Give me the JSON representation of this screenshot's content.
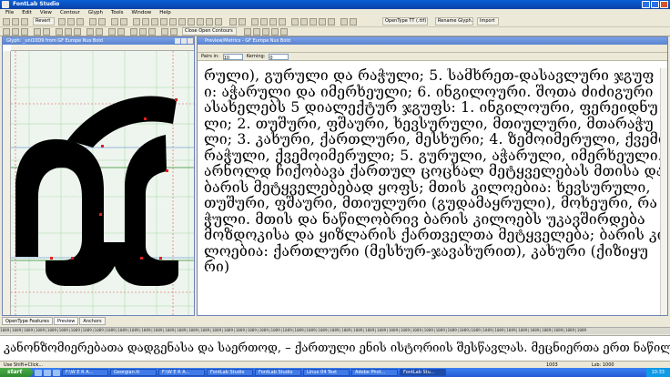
{
  "app": {
    "title": "FontLab Studio"
  },
  "menu": [
    "File",
    "Edit",
    "View",
    "Contour",
    "Glyph",
    "Tools",
    "Window",
    "Help"
  ],
  "toolbar": {
    "revert_label": "Revert",
    "layer_dropdown": "OpenType TT (.ttf)",
    "rename_glyph_label": "Rename Glyph...",
    "import_label": "Import",
    "close_contours_label": "Close Open Contours"
  },
  "glyph_window": {
    "title": "Glyph: _uni10D9 from GF Europe Nus Bold"
  },
  "preview_window": {
    "title": "Preview/Metrics - GF Europe Nus Bold",
    "pairs_label": "Pairs in:",
    "pairs_value": "10",
    "kerning_label": "Kerning:",
    "kerning_value": "0",
    "text_lines": [
      "რული), გურული და რაჭული; 5. სამხრეთ-დასავლური ჯგუფ",
      "ი: აჭარული და იმერხეული; 6. ინგილოური. შოთა ძიძიგური",
      "ასახელებს 5 დიალექტურ ჯგუფს: 1. ინგილოური, ფერეიდნუ",
      "ლი; 2. თუშური, ფშაური, ხევსურული, მთიულური, მთარაჭუ",
      "ლი; 3. კახური, ქართლური, მესხური; 4. ზემოიმერული, ქვემო",
      "რაჭული, ქვემოიმერული; 5. გურული, აჭარული, იმერხეული.",
      "არნოლდ ჩიქობავა ქართულ ცოცხალ მეტყველებას მთისა და",
      " ბარის მეტყველებებად ყოფს; მთის კილოებია: ხევსურული,",
      "თუშური, ფშაური, მთიულური (გუდამაყრული), მოხეური, რა",
      "ჭული. მთის და ნაწილობრივ ბარის კილოებს უკავშირდება",
      "მოზდოკისა და ყიზლარის ქართველთა მეტყველება; ბარის კი",
      "ლოებია: ქართლური (მესხურ-ჯავახურით), კახური (ქიზიყუ",
      "რი)"
    ]
  },
  "tabs": [
    "OpenType Features",
    "Preview",
    "Anchors"
  ],
  "metrics_strip": "1089|1089|1089|1089|1089|1089|1089|1089|1089|1089|1089|1089|1089|1089|1089|1089|1089|1089|1089|1089|1089|1089|1089|1089|1089|1089|1089|1089|1089|1089|1089|1089|1089|1089|1089|1089|1089|1089|1089|1089|1089|1089|1089|1089|1089|1089|1089|1089|1089|1089",
  "bottom_text": "კანონზომიერებათა დადგენასა და საერთოდ, – ქართული ენის ისტორიის შესწავლას. მეცნიერთა ერთ ნაწილს მიაჩნია, რო",
  "status": {
    "left": "Use Shift+Click...",
    "mid": "1003",
    "coords": "Lsb: 1000"
  },
  "taskbar": {
    "start": "start",
    "tasks": [
      "F:\\W E R A...",
      "Georgian.tt",
      "F:\\W E R A...",
      "FontLab Studio",
      "FontLab Studio",
      "Linux 04 Text",
      "Adobe Phot...",
      "FontLab Stu..."
    ],
    "tray_time": "10:33"
  }
}
